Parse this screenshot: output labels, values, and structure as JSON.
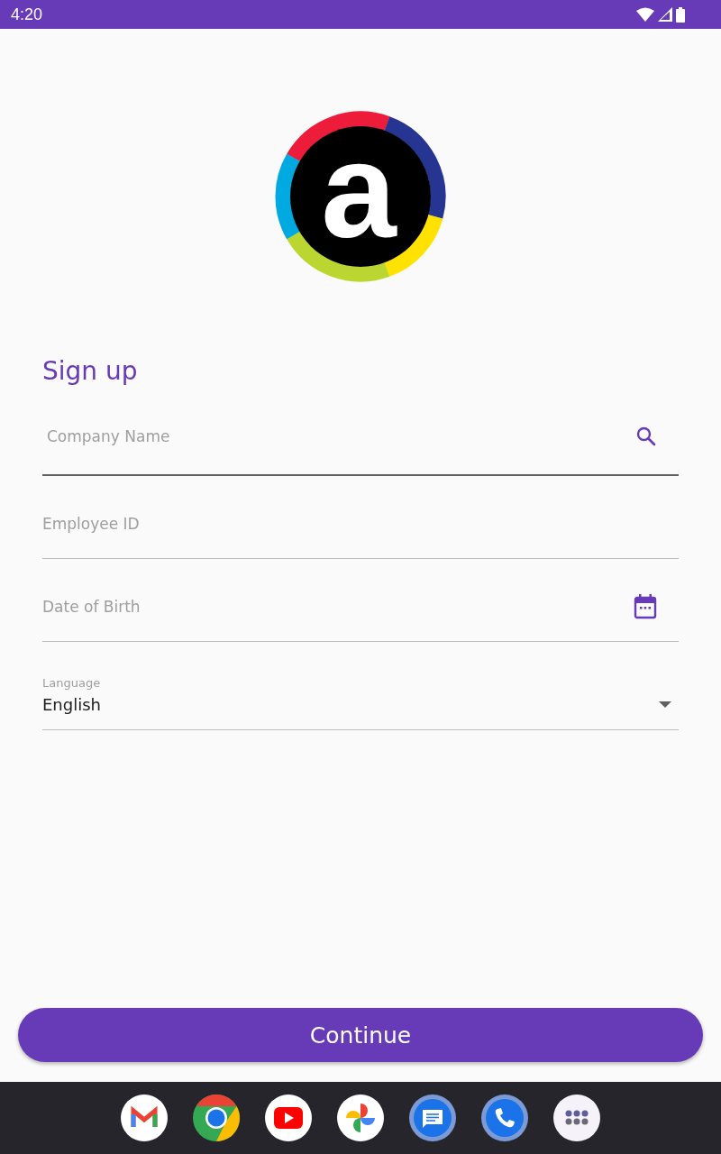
{
  "status_bar": {
    "time": "4:20"
  },
  "logo": {
    "letter": "a"
  },
  "form": {
    "title": "Sign up",
    "fields": [
      {
        "kind": "search",
        "placeholder": "Company Name"
      },
      {
        "kind": "text",
        "placeholder": "Employee ID"
      },
      {
        "kind": "date",
        "placeholder": "Date of Birth"
      },
      {
        "kind": "dropdown",
        "label": "Language",
        "value": "English"
      }
    ]
  },
  "continue_button": {
    "label": "Continue"
  }
}
